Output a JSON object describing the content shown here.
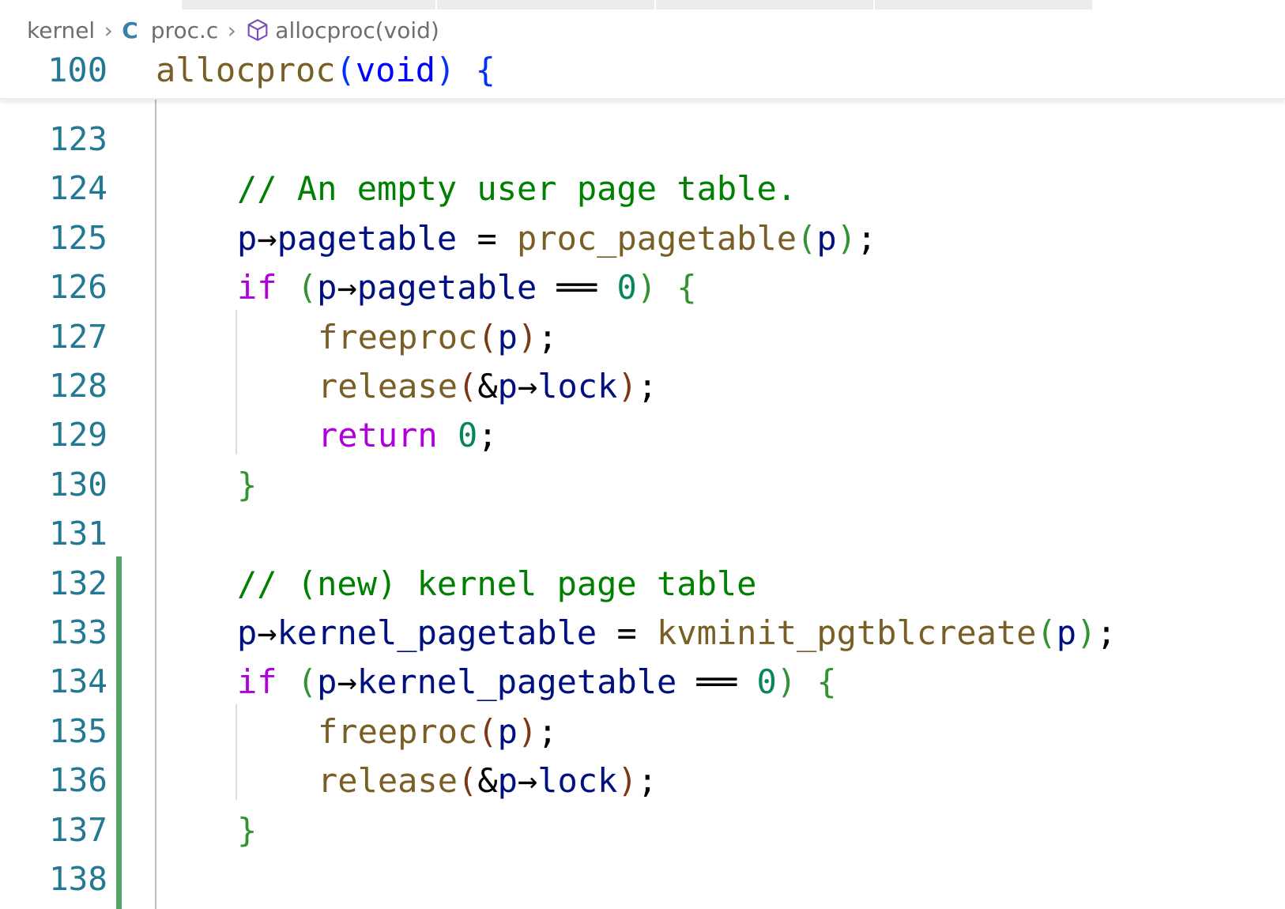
{
  "breadcrumb": {
    "folder": "kernel",
    "lang_icon": "C",
    "file": "proc.c",
    "symbol_icon": "cube-icon",
    "symbol": "allocproc(void)"
  },
  "sticky": {
    "line_number": "100",
    "tokens": [
      {
        "t": "allocproc",
        "c": "t-fn"
      },
      {
        "t": "(",
        "c": "t-par1"
      },
      {
        "t": "void",
        "c": "t-typ"
      },
      {
        "t": ")",
        "c": "t-par1"
      },
      {
        "t": " ",
        "c": "t-op"
      },
      {
        "t": "{",
        "c": "t-par1"
      }
    ]
  },
  "colors": {
    "line_number": "#237893",
    "comment": "#008000",
    "function": "#795e26",
    "keyword": "#af00db",
    "variable": "#001080",
    "type": "#0000ff",
    "number": "#098658",
    "diff_added": "#55a366"
  },
  "lines": [
    {
      "n": "123",
      "indent": 0,
      "tokens": []
    },
    {
      "n": "124",
      "indent": 1,
      "tokens": [
        {
          "t": "// An empty user page table.",
          "c": "t-cmt"
        }
      ]
    },
    {
      "n": "125",
      "indent": 1,
      "tokens": [
        {
          "t": "p",
          "c": "t-var"
        },
        {
          "t": "→",
          "c": "t-op"
        },
        {
          "t": "pagetable",
          "c": "t-var"
        },
        {
          "t": " = ",
          "c": "t-op"
        },
        {
          "t": "proc_pagetable",
          "c": "t-fn"
        },
        {
          "t": "(",
          "c": "t-par2"
        },
        {
          "t": "p",
          "c": "t-var"
        },
        {
          "t": ")",
          "c": "t-par2"
        },
        {
          "t": ";",
          "c": "t-op"
        }
      ]
    },
    {
      "n": "126",
      "indent": 1,
      "tokens": [
        {
          "t": "if",
          "c": "t-kw"
        },
        {
          "t": " ",
          "c": "t-op"
        },
        {
          "t": "(",
          "c": "t-par2"
        },
        {
          "t": "p",
          "c": "t-var"
        },
        {
          "t": "→",
          "c": "t-op"
        },
        {
          "t": "pagetable",
          "c": "t-var"
        },
        {
          "t": " ══ ",
          "c": "t-op"
        },
        {
          "t": "0",
          "c": "t-num"
        },
        {
          "t": ")",
          "c": "t-par2"
        },
        {
          "t": " ",
          "c": "t-op"
        },
        {
          "t": "{",
          "c": "t-par2"
        }
      ]
    },
    {
      "n": "127",
      "indent": 2,
      "tokens": [
        {
          "t": "freeproc",
          "c": "t-fn"
        },
        {
          "t": "(",
          "c": "t-par3"
        },
        {
          "t": "p",
          "c": "t-var"
        },
        {
          "t": ")",
          "c": "t-par3"
        },
        {
          "t": ";",
          "c": "t-op"
        }
      ]
    },
    {
      "n": "128",
      "indent": 2,
      "tokens": [
        {
          "t": "release",
          "c": "t-fn"
        },
        {
          "t": "(",
          "c": "t-par3"
        },
        {
          "t": "&",
          "c": "t-op"
        },
        {
          "t": "p",
          "c": "t-var"
        },
        {
          "t": "→",
          "c": "t-op"
        },
        {
          "t": "lock",
          "c": "t-var"
        },
        {
          "t": ")",
          "c": "t-par3"
        },
        {
          "t": ";",
          "c": "t-op"
        }
      ]
    },
    {
      "n": "129",
      "indent": 2,
      "tokens": [
        {
          "t": "return",
          "c": "t-kw"
        },
        {
          "t": " ",
          "c": "t-op"
        },
        {
          "t": "0",
          "c": "t-num"
        },
        {
          "t": ";",
          "c": "t-op"
        }
      ]
    },
    {
      "n": "130",
      "indent": 1,
      "tokens": [
        {
          "t": "}",
          "c": "t-par2"
        }
      ]
    },
    {
      "n": "131",
      "indent": 0,
      "tokens": []
    },
    {
      "n": "132",
      "indent": 1,
      "tokens": [
        {
          "t": "// (new) kernel page table",
          "c": "t-cmt"
        }
      ]
    },
    {
      "n": "133",
      "indent": 1,
      "tokens": [
        {
          "t": "p",
          "c": "t-var"
        },
        {
          "t": "→",
          "c": "t-op"
        },
        {
          "t": "kernel_pagetable",
          "c": "t-var"
        },
        {
          "t": " = ",
          "c": "t-op"
        },
        {
          "t": "kvminit_pgtblcreate",
          "c": "t-fn"
        },
        {
          "t": "(",
          "c": "t-par2"
        },
        {
          "t": "p",
          "c": "t-var"
        },
        {
          "t": ")",
          "c": "t-par2"
        },
        {
          "t": ";",
          "c": "t-op"
        }
      ]
    },
    {
      "n": "134",
      "indent": 1,
      "tokens": [
        {
          "t": "if",
          "c": "t-kw"
        },
        {
          "t": " ",
          "c": "t-op"
        },
        {
          "t": "(",
          "c": "t-par2"
        },
        {
          "t": "p",
          "c": "t-var"
        },
        {
          "t": "→",
          "c": "t-op"
        },
        {
          "t": "kernel_pagetable",
          "c": "t-var"
        },
        {
          "t": " ══ ",
          "c": "t-op"
        },
        {
          "t": "0",
          "c": "t-num"
        },
        {
          "t": ")",
          "c": "t-par2"
        },
        {
          "t": " ",
          "c": "t-op"
        },
        {
          "t": "{",
          "c": "t-par2"
        }
      ]
    },
    {
      "n": "135",
      "indent": 2,
      "tokens": [
        {
          "t": "freeproc",
          "c": "t-fn"
        },
        {
          "t": "(",
          "c": "t-par3"
        },
        {
          "t": "p",
          "c": "t-var"
        },
        {
          "t": ")",
          "c": "t-par3"
        },
        {
          "t": ";",
          "c": "t-op"
        }
      ]
    },
    {
      "n": "136",
      "indent": 2,
      "tokens": [
        {
          "t": "release",
          "c": "t-fn"
        },
        {
          "t": "(",
          "c": "t-par3"
        },
        {
          "t": "&",
          "c": "t-op"
        },
        {
          "t": "p",
          "c": "t-var"
        },
        {
          "t": "→",
          "c": "t-op"
        },
        {
          "t": "lock",
          "c": "t-var"
        },
        {
          "t": ")",
          "c": "t-par3"
        },
        {
          "t": ";",
          "c": "t-op"
        }
      ]
    },
    {
      "n": "137",
      "indent": 1,
      "tokens": [
        {
          "t": "}",
          "c": "t-par2"
        }
      ]
    },
    {
      "n": "138",
      "indent": 0,
      "tokens": []
    }
  ]
}
